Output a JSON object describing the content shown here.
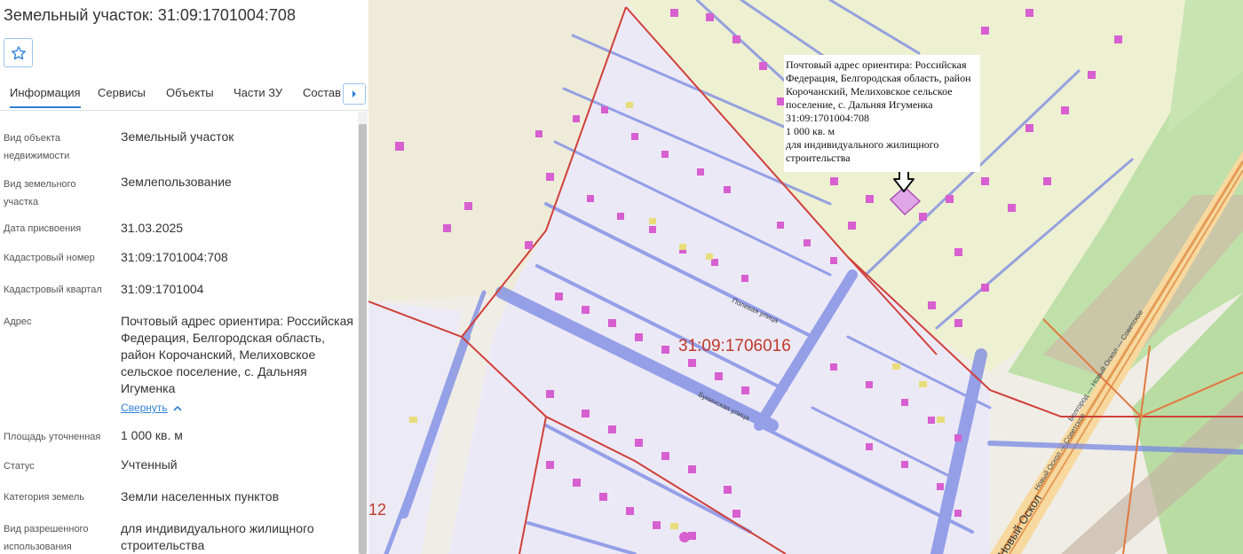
{
  "header": {
    "title": "Земельный участок: 31:09:1701004:708",
    "favorite_icon": "star-icon"
  },
  "tabs": [
    {
      "label": "Информация",
      "active": true
    },
    {
      "label": "Сервисы"
    },
    {
      "label": "Объекты"
    },
    {
      "label": "Части ЗУ"
    },
    {
      "label": "Состав"
    }
  ],
  "tabs_next_icon": "chevron-right-icon",
  "properties": {
    "object_type": {
      "label": "Вид объекта недвижимости",
      "value": "Земельный участок"
    },
    "land_type": {
      "label": "Вид земельного участка",
      "value": "Землепользование"
    },
    "assigned_date": {
      "label": "Дата присвоения",
      "value": "31.03.2025"
    },
    "cadastral_number": {
      "label": "Кадастровый номер",
      "value": "31:09:1701004:708"
    },
    "cadastral_quarter": {
      "label": "Кадастровый квартал",
      "value": "31:09:1701004"
    },
    "address": {
      "label": "Адрес",
      "value": "Почтовый адрес ориентира: Российская Федерация, Белгородская область, район Корочанский, Мелиховское сельское поселение, с. Дальняя Игуменка"
    },
    "collapse_label": "Свернуть",
    "area": {
      "label": "Площадь уточненная",
      "value": "1 000 кв. м"
    },
    "status": {
      "label": "Статус",
      "value": "Учтенный"
    },
    "land_category": {
      "label": "Категория земель",
      "value": "Земли населенных пунктов"
    },
    "permitted_use": {
      "label": "Вид разрешенного использования",
      "value": "для индивидуального жилищного строительства"
    }
  },
  "map": {
    "popup": {
      "address": "Почтовый адрес ориентира: Российская Федерация, Белгородская область, район Корочанский, Мелиховское сельское поселение, с. Дальняя Игуменка",
      "cadastral_number": "31:09:1701004:708",
      "area": "1 000 кв. м",
      "use": "для индивидуального жилищного строительства"
    },
    "quarter_label": "31:09:1706016",
    "edge_label": "12",
    "streets": {
      "poleva": "Полевая улица",
      "bunina": "Бунинская улица",
      "highway": "Новый Оскол",
      "highway2": "Белгород — Новый Оскол — Советское",
      "highway3": "Новый Оскол — Советское"
    },
    "colors": {
      "parcel": "#d45fd0",
      "boundary": "#d0403a",
      "road_blue": "#6a7fe0",
      "forest": "#b4d9a0",
      "selected": "#e0a7e6"
    }
  }
}
